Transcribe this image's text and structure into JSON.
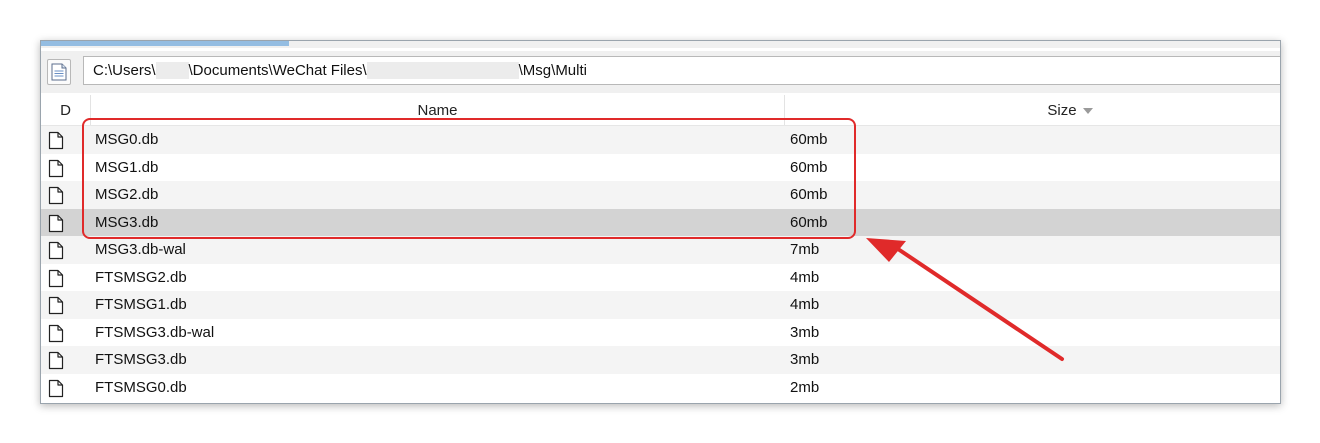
{
  "window": {
    "progress_fraction": 0.2
  },
  "address_bar": {
    "path_prefix": "C:\\Users\\",
    "path_middle": "\\Documents\\WeChat Files\\",
    "path_suffix": "\\Msg\\Multi",
    "page_icon": "page-icon"
  },
  "columns": {
    "d": "D",
    "name": "Name",
    "size": "Size"
  },
  "files": [
    {
      "name": "MSG0.db",
      "size": "60mb"
    },
    {
      "name": "MSG1.db",
      "size": "60mb"
    },
    {
      "name": "MSG2.db",
      "size": "60mb"
    },
    {
      "name": "MSG3.db",
      "size": "60mb",
      "selected": true
    },
    {
      "name": "MSG3.db-wal",
      "size": "7mb"
    },
    {
      "name": "FTSMSG2.db",
      "size": "4mb"
    },
    {
      "name": "FTSMSG1.db",
      "size": "4mb"
    },
    {
      "name": "FTSMSG3.db-wal",
      "size": "3mb"
    },
    {
      "name": "FTSMSG3.db",
      "size": "3mb"
    },
    {
      "name": "FTSMSG0.db",
      "size": "2mb"
    }
  ],
  "annotation": {
    "color": "#e02a2a",
    "highlight_icon": "red-rectangle-highlight",
    "arrow_icon": "red-arrow"
  }
}
